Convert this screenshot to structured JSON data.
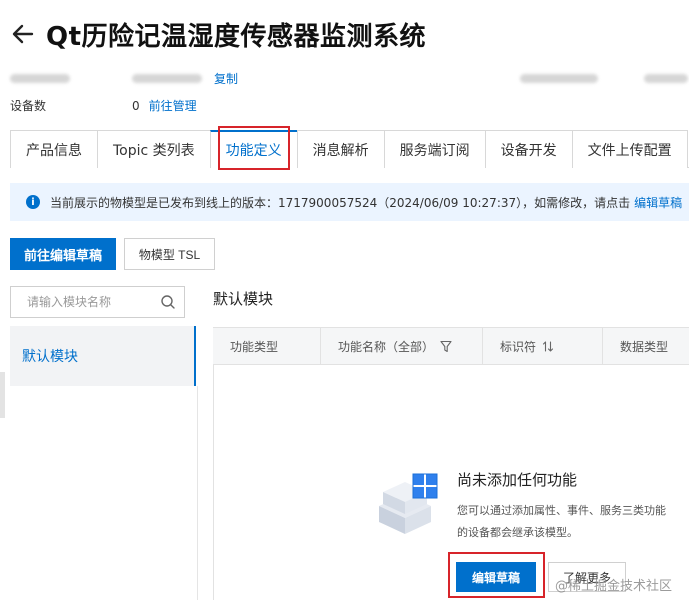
{
  "header": {
    "title": "Qt历险记温湿度传感器监测系统"
  },
  "meta": {
    "copy_label": "复制",
    "device_count_label": "设备数",
    "device_count_value": "0",
    "manage_link": "前往管理"
  },
  "tabs": [
    {
      "label": "产品信息",
      "active": false
    },
    {
      "label": "Topic 类列表",
      "active": false
    },
    {
      "label": "功能定义",
      "active": true
    },
    {
      "label": "消息解析",
      "active": false
    },
    {
      "label": "服务端订阅",
      "active": false
    },
    {
      "label": "设备开发",
      "active": false
    },
    {
      "label": "文件上传配置",
      "active": false
    }
  ],
  "notice": {
    "text": "当前展示的物模型是已发布到线上的版本：1717900057524（2024/06/09 10:27:37），如需修改，请点击",
    "link": "编辑草稿"
  },
  "toolbar": {
    "edit_draft_button": "前往编辑草稿",
    "tsl_button": "物模型 TSL"
  },
  "search": {
    "placeholder": "请输入模块名称"
  },
  "modules": {
    "items": [
      {
        "label": "默认模块"
      }
    ]
  },
  "section": {
    "title": "默认模块"
  },
  "table": {
    "columns": [
      "功能类型",
      "功能名称（全部）",
      "标识符",
      "数据类型"
    ]
  },
  "empty": {
    "title": "尚未添加任何功能",
    "desc_line1": "您可以通过添加属性、事件、服务三类功能",
    "desc_line2": "的设备都会继承该模型。",
    "edit_button": "编辑草稿",
    "learn_button": "了解更多"
  },
  "watermark": {
    "text": "@稀土掘金技术社区"
  },
  "colors": {
    "primary": "#0070cc",
    "highlight_box": "#d7242a",
    "notice_bg": "#ebf4ff"
  }
}
